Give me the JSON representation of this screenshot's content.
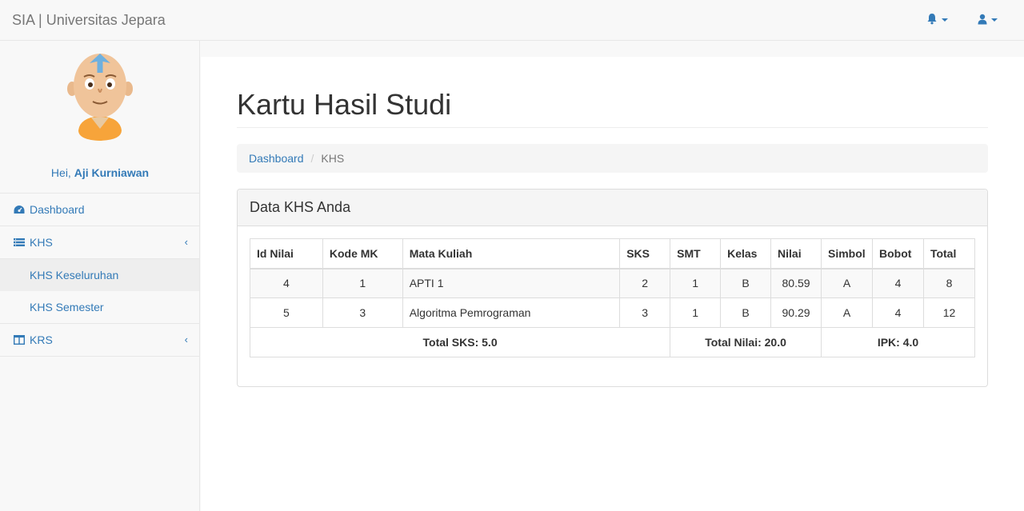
{
  "navbar": {
    "brand": "SIA | Universitas Jepara",
    "bell_icon": "bell-icon",
    "user_icon": "user-icon"
  },
  "sidebar": {
    "greeting_prefix": "Hei,",
    "user_name": "Aji Kurniawan",
    "items": [
      {
        "label": "Dashboard",
        "icon": "dashboard-icon"
      },
      {
        "label": "KHS",
        "icon": "list-icon",
        "chevron": "‹",
        "children": [
          {
            "label": "KHS Keseluruhan",
            "active": true
          },
          {
            "label": "KHS Semester",
            "active": false
          }
        ]
      },
      {
        "label": "KRS",
        "icon": "columns-icon",
        "chevron": "‹"
      }
    ]
  },
  "main": {
    "title": "Kartu Hasil Studi",
    "breadcrumb": {
      "home": "Dashboard",
      "separator": "/",
      "current": "KHS"
    },
    "panel_title": "Data KHS Anda",
    "table": {
      "headers": [
        "Id Nilai",
        "Kode MK",
        "Mata Kuliah",
        "SKS",
        "SMT",
        "Kelas",
        "Nilai",
        "Simbol",
        "Bobot",
        "Total"
      ],
      "rows": [
        [
          "4",
          "1",
          "APTI 1",
          "2",
          "1",
          "B",
          "80.59",
          "A",
          "4",
          "8"
        ],
        [
          "5",
          "3",
          "Algoritma Pemrograman",
          "3",
          "1",
          "B",
          "90.29",
          "A",
          "4",
          "12"
        ]
      ],
      "footer": {
        "total_sks": "Total SKS: 5.0",
        "total_nilai": "Total Nilai: 20.0",
        "ipk": "IPK: 4.0"
      }
    }
  },
  "colors": {
    "link": "#337ab7",
    "navbar_bg": "#f8f8f8",
    "panel_heading_bg": "#f5f5f5"
  }
}
